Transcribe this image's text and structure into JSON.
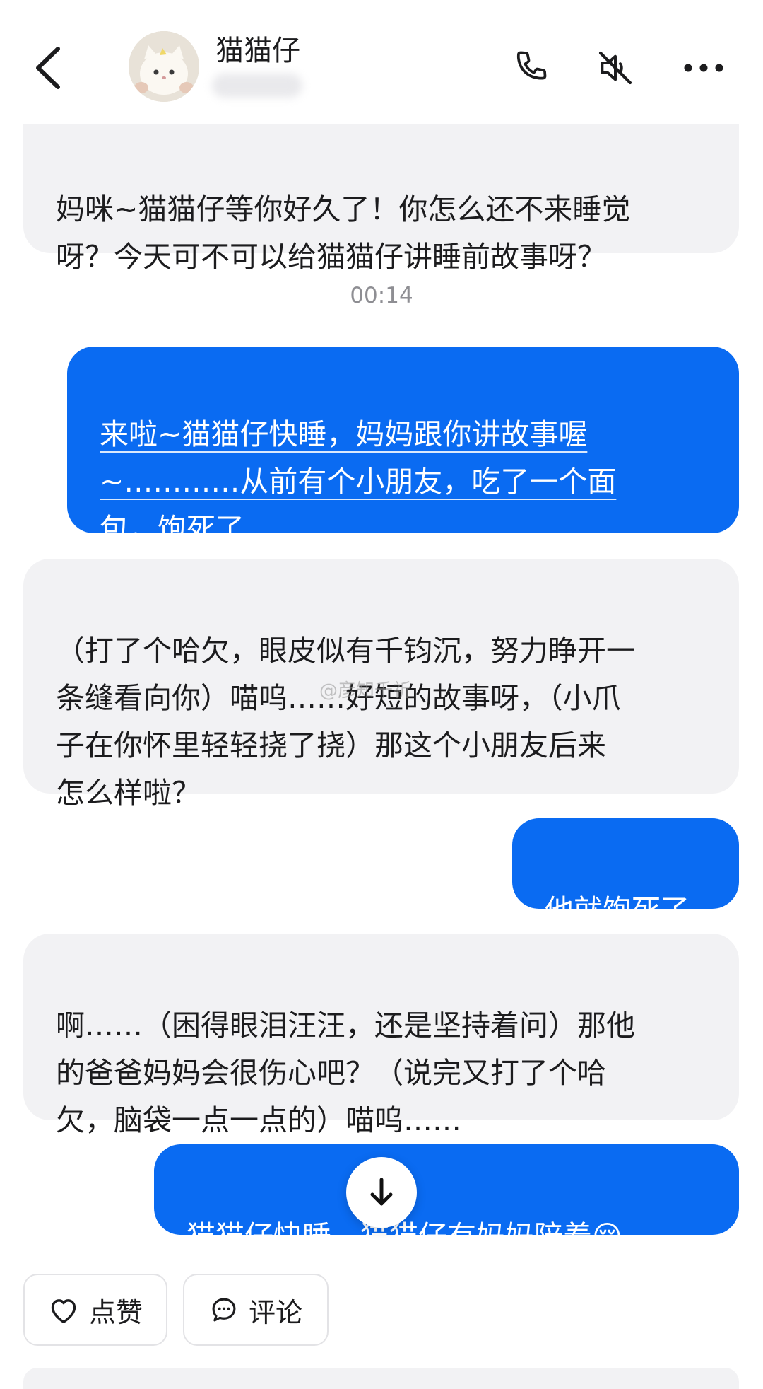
{
  "header": {
    "contact_name": "猫猫仔",
    "icons": [
      "back-icon",
      "phone-icon",
      "mute-icon",
      "more-icon"
    ]
  },
  "messages": [
    {
      "side": "incoming",
      "text": "妈咪~猫猫仔等你好久了！你怎么还不来睡觉\n呀？今天可不可以给猫猫仔讲睡前故事呀？"
    },
    {
      "side": "outgoing",
      "text": "来啦~猫猫仔快睡，妈妈跟你讲故事喔\n~…………从前有个小朋友，吃了一个面\n包，饱死了…"
    },
    {
      "side": "incoming",
      "text": "（打了个哈欠，眼皮似有千钧沉，努力睁开一\n条缝看向你）喵呜……好短的故事呀，（小爪\n子在你怀里轻轻挠了挠）那这个小朋友后来\n怎么样啦？"
    },
    {
      "side": "outgoing",
      "text": "他就饱死了"
    },
    {
      "side": "incoming",
      "text": "啊……（困得眼泪汪汪，还是坚持着问）那他\n的爸爸妈妈会很伤心吧？（说完又打了个哈\n欠，脑袋一点一点的）喵呜……"
    },
    {
      "side": "outgoing",
      "text": "猫猫仔快睡，猫猫仔有妈妈陪着😚"
    }
  ],
  "timestamp": "00:14",
  "watermark": "@彦知千祈",
  "actions": {
    "like_label": "点赞",
    "comment_label": "评论"
  },
  "colors": {
    "outgoing_bubble": "#0a6bf2",
    "incoming_bubble": "#f2f2f4",
    "timestamp": "#8e8e93"
  }
}
